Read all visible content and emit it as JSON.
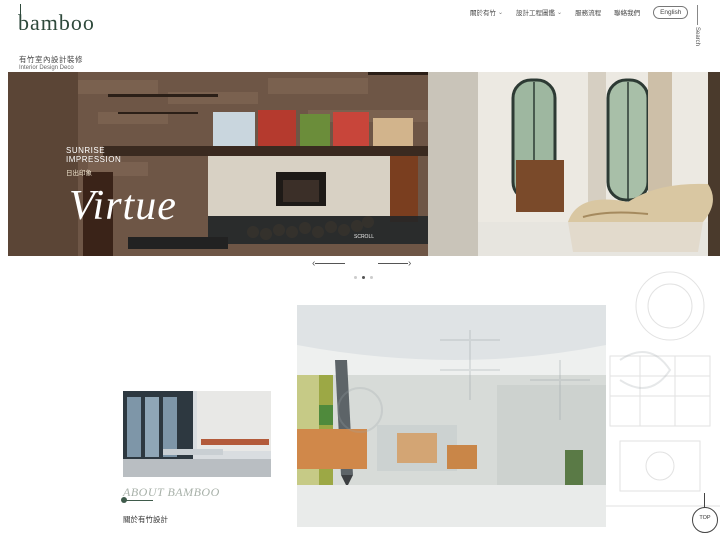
{
  "logo": {
    "wordmark": "bamboo",
    "cn_name": "有竹室內設計裝修",
    "en_name": "Interior Design Deco"
  },
  "nav": {
    "items": [
      {
        "label": "關於有竹",
        "has_dropdown": true
      },
      {
        "label": "設計工程圖鑑",
        "has_dropdown": true
      },
      {
        "label": "服務流程",
        "has_dropdown": false
      },
      {
        "label": "聯絡我們",
        "has_dropdown": false
      }
    ],
    "language_button": "English",
    "search_label": "Search"
  },
  "hero": {
    "subtitle_en_line1": "SUNRISE",
    "subtitle_en_line2": "IMPRESSION",
    "subtitle_cn": "日出印象",
    "title": "Virtue",
    "scroll_label": "SCROLL",
    "slide_count": 3,
    "active_slide": 2
  },
  "about": {
    "title": "ABOUT BAMBOO",
    "subtitle": "關於有竹設計"
  },
  "top_button": {
    "label": "TOP"
  },
  "colors": {
    "brand": "#2f4a3c",
    "accent_gray": "#a8b1a9"
  },
  "icons": {
    "search": "search-line-icon",
    "prev": "arrow-left-icon",
    "next": "arrow-right-icon",
    "top": "arrow-up-icon"
  }
}
